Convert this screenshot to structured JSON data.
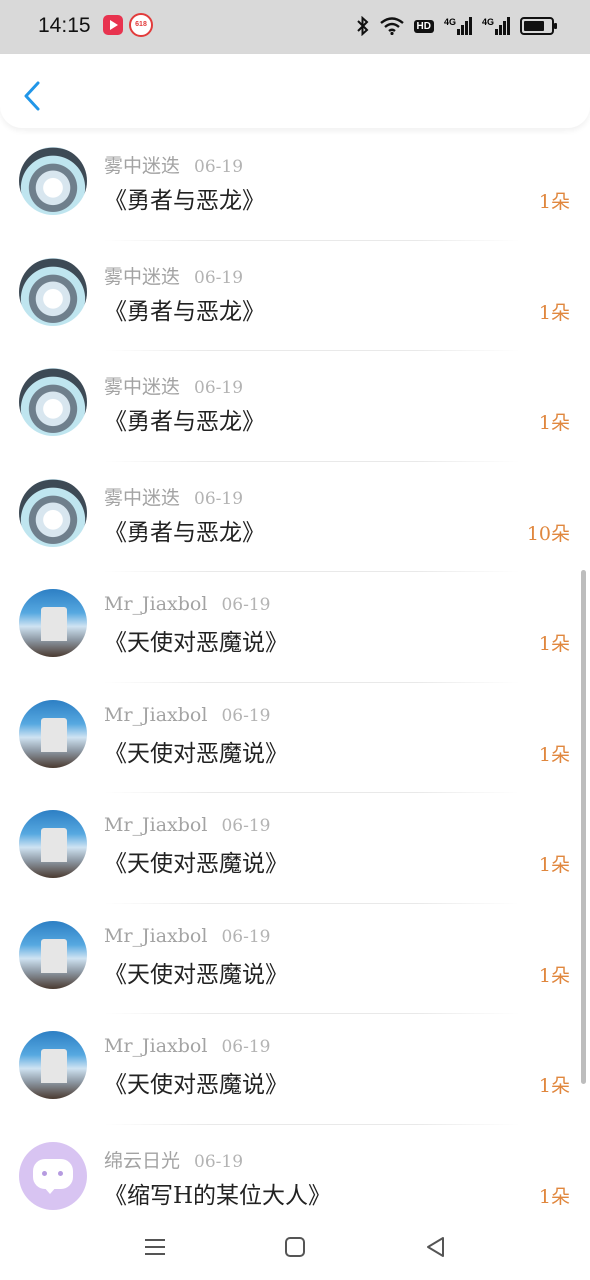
{
  "status_bar": {
    "time": "14:15",
    "badge_618": "618",
    "hd_label": "HD",
    "signal_1": "4G",
    "signal_2": "4G"
  },
  "header": {
    "back_icon": "chevron-left-icon",
    "accent_color": "#2196e8"
  },
  "colors": {
    "count_color": "#e0873e",
    "name_color": "#a3a3a3",
    "title_color": "#222222"
  },
  "items": [
    {
      "avatar": "anime-girl",
      "name": "雾中迷迭",
      "date": "06-19",
      "title": "《勇者与恶龙》",
      "count": "1朵"
    },
    {
      "avatar": "anime-girl",
      "name": "雾中迷迭",
      "date": "06-19",
      "title": "《勇者与恶龙》",
      "count": "1朵"
    },
    {
      "avatar": "anime-girl",
      "name": "雾中迷迭",
      "date": "06-19",
      "title": "《勇者与恶龙》",
      "count": "1朵"
    },
    {
      "avatar": "anime-girl",
      "name": "雾中迷迭",
      "date": "06-19",
      "title": "《勇者与恶龙》",
      "count": "10朵"
    },
    {
      "avatar": "sky-clouds",
      "name": "Mr_Jiaxbol",
      "date": "06-19",
      "title": "《天使对恶魔说》",
      "count": "1朵"
    },
    {
      "avatar": "sky-clouds",
      "name": "Mr_Jiaxbol",
      "date": "06-19",
      "title": "《天使对恶魔说》",
      "count": "1朵"
    },
    {
      "avatar": "sky-clouds",
      "name": "Mr_Jiaxbol",
      "date": "06-19",
      "title": "《天使对恶魔说》",
      "count": "1朵"
    },
    {
      "avatar": "sky-clouds",
      "name": "Mr_Jiaxbol",
      "date": "06-19",
      "title": "《天使对恶魔说》",
      "count": "1朵"
    },
    {
      "avatar": "sky-clouds",
      "name": "Mr_Jiaxbol",
      "date": "06-19",
      "title": "《天使对恶魔说》",
      "count": "1朵"
    },
    {
      "avatar": "chat-bubble",
      "name": "绵云日光",
      "date": "06-19",
      "title": "《缩写H的某位大人》",
      "count": "1朵"
    }
  ],
  "nav_bar": {
    "menu_icon": "menu-icon",
    "home_icon": "home-square-icon",
    "back_icon": "back-triangle-icon"
  }
}
